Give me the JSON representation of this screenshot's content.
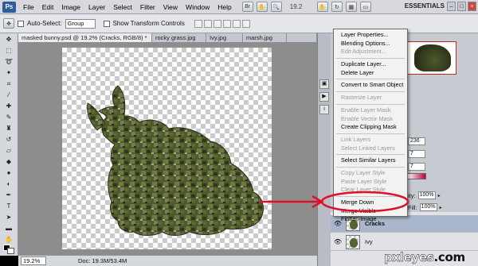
{
  "menubar": {
    "logo": "Ps",
    "items": [
      "File",
      "Edit",
      "Image",
      "Layer",
      "Select",
      "Filter",
      "View",
      "Window",
      "Help"
    ],
    "zoom": "19.2",
    "workspace": "ESSENTIALS",
    "window_buttons": [
      "–",
      "□",
      "×"
    ]
  },
  "options_bar": {
    "auto_select_label": "Auto-Select:",
    "auto_select_value": "Group",
    "show_transform_label": "Show Transform Controls"
  },
  "tabs": [
    {
      "label": "masked bunny.psd @ 19.2% (Cracks, RGB/8) *",
      "active": true
    },
    {
      "label": "rocky grass.jpg",
      "active": false
    },
    {
      "label": "Ivy.jpg",
      "active": false
    },
    {
      "label": "marsh.jpg",
      "active": false
    },
    {
      "label": "",
      "active": false
    }
  ],
  "status_bar": {
    "zoom": "19.2%",
    "doc": "Doc: 19.3M/53.4M"
  },
  "context_menu": {
    "items": [
      {
        "label": "Layer Properties...",
        "enabled": true
      },
      {
        "label": "Blending Options...",
        "enabled": true
      },
      {
        "label": "Edit Adjustment...",
        "enabled": false
      },
      {
        "sep": true
      },
      {
        "label": "Duplicate Layer...",
        "enabled": true
      },
      {
        "label": "Delete Layer",
        "enabled": true
      },
      {
        "sep": true
      },
      {
        "label": "Convert to Smart Object",
        "enabled": true
      },
      {
        "sep": true
      },
      {
        "label": "Rasterize Layer",
        "enabled": false
      },
      {
        "sep": true
      },
      {
        "label": "Enable Layer Mask",
        "enabled": false
      },
      {
        "label": "Enable Vector Mask",
        "enabled": false
      },
      {
        "label": "Create Clipping Mask",
        "enabled": true
      },
      {
        "sep": true
      },
      {
        "label": "Link Layers",
        "enabled": false
      },
      {
        "label": "Select Linked Layers",
        "enabled": false
      },
      {
        "sep": true
      },
      {
        "label": "Select Similar Layers",
        "enabled": true
      },
      {
        "sep": true
      },
      {
        "label": "Copy Layer Style",
        "enabled": false
      },
      {
        "label": "Paste Layer Style",
        "enabled": false
      },
      {
        "label": "Clear Layer Style",
        "enabled": false
      },
      {
        "sep": true
      },
      {
        "label": "Merge Down",
        "enabled": true
      },
      {
        "label": "Merge Visible",
        "enabled": true
      },
      {
        "label": "Flatten Image",
        "enabled": true
      }
    ]
  },
  "panels": {
    "fields": [
      "236",
      "7",
      "7"
    ],
    "opacity_label": "ity:",
    "opacity_value": "100%",
    "fill_label": "Fill:",
    "fill_value": "100%",
    "layers": [
      {
        "name": "Cracks",
        "selected": true
      },
      {
        "name": "Ivy",
        "selected": false
      }
    ]
  },
  "watermark": {
    "main": "pxleyes",
    "suffix": ".com"
  },
  "colors": {
    "annotation": "#e0102a",
    "menu_bg": "#f2f2f2",
    "canvas_bg": "#8d8d8d"
  },
  "icons": [
    "move-tool-icon",
    "marquee-tool-icon",
    "lasso-tool-icon",
    "magic-wand-icon",
    "crop-tool-icon",
    "eyedropper-icon",
    "healing-brush-icon",
    "brush-tool-icon",
    "clone-stamp-icon",
    "history-brush-icon",
    "eraser-icon",
    "paint-bucket-icon",
    "blur-tool-icon",
    "dodge-tool-icon",
    "pen-tool-icon",
    "type-tool-icon",
    "path-select-icon",
    "shape-tool-icon",
    "hand-tool-icon",
    "zoom-tool-icon",
    "eye-icon"
  ]
}
